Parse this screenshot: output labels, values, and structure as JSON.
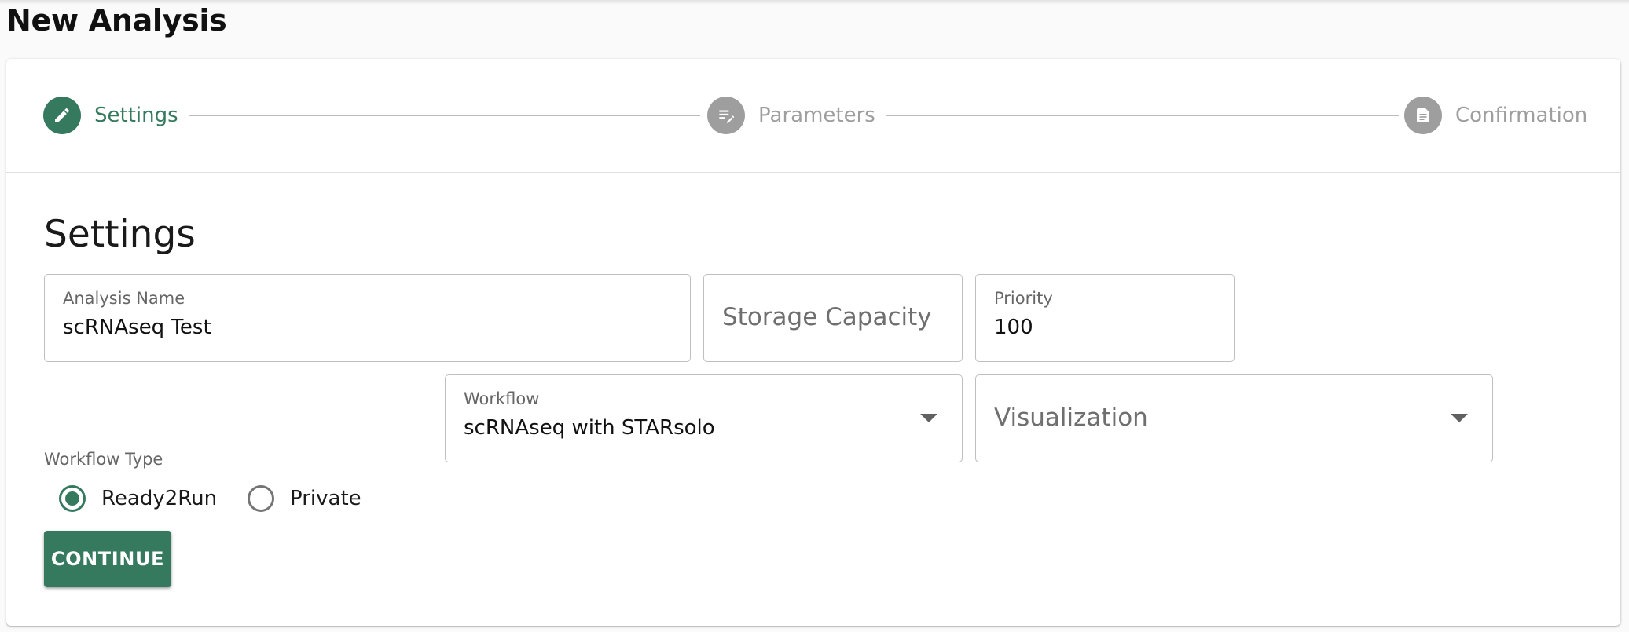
{
  "page": {
    "title": "New Analysis"
  },
  "stepper": {
    "steps": [
      {
        "label": "Settings",
        "icon": "pencil-icon",
        "state": "active"
      },
      {
        "label": "Parameters",
        "icon": "list-edit-icon",
        "state": "inactive"
      },
      {
        "label": "Confirmation",
        "icon": "document-icon",
        "state": "inactive"
      }
    ]
  },
  "settings": {
    "heading": "Settings",
    "analysis_name": {
      "label": "Analysis Name",
      "value": "scRNAseq Test"
    },
    "storage_capacity": {
      "placeholder": "Storage Capacity"
    },
    "priority": {
      "label": "Priority",
      "value": "100"
    },
    "workflow_type": {
      "label": "Workflow Type",
      "options": [
        {
          "label": "Ready2Run",
          "selected": true
        },
        {
          "label": "Private",
          "selected": false
        }
      ]
    },
    "workflow": {
      "label": "Workflow",
      "value": "scRNAseq with STARsolo"
    },
    "visualization": {
      "placeholder": "Visualization"
    }
  },
  "actions": {
    "continue_label": "CONTINUE"
  },
  "colors": {
    "accent": "#357a5f",
    "inactive": "#9e9e9e",
    "border": "#bfbfbf"
  }
}
